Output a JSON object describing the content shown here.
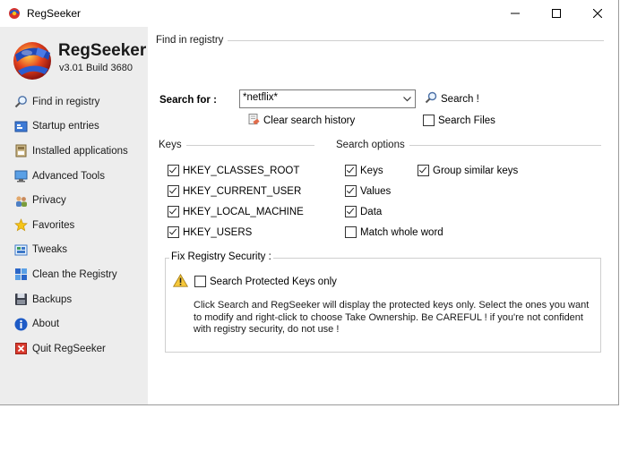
{
  "window": {
    "title": "RegSeeker"
  },
  "sidebar": {
    "app_name": "RegSeeker",
    "version": "v3.01 Build 3680",
    "items": [
      {
        "label": "Find in registry",
        "icon": "magnifier-icon"
      },
      {
        "label": "Startup entries",
        "icon": "startup-icon"
      },
      {
        "label": "Installed applications",
        "icon": "applications-icon"
      },
      {
        "label": "Advanced Tools",
        "icon": "monitor-icon"
      },
      {
        "label": "Privacy",
        "icon": "users-icon"
      },
      {
        "label": "Favorites",
        "icon": "star-icon"
      },
      {
        "label": "Tweaks",
        "icon": "tweaks-icon"
      },
      {
        "label": "Clean the Registry",
        "icon": "registry-icon"
      },
      {
        "label": "Backups",
        "icon": "disk-icon"
      },
      {
        "label": "About",
        "icon": "info-icon"
      },
      {
        "label": "Quit RegSeeker",
        "icon": "quit-icon"
      }
    ]
  },
  "main": {
    "section_title": "Find in registry",
    "search_label": "Search for :",
    "search_value": "*netflix*",
    "search_button": "Search !",
    "clear_history": "Clear search history",
    "search_files": {
      "label": "Search Files",
      "checked": false
    },
    "keys_group": "Keys",
    "keys": [
      {
        "label": "HKEY_CLASSES_ROOT",
        "checked": true
      },
      {
        "label": "HKEY_CURRENT_USER",
        "checked": true
      },
      {
        "label": "HKEY_LOCAL_MACHINE",
        "checked": true
      },
      {
        "label": "HKEY_USERS",
        "checked": true
      }
    ],
    "options_group": "Search options",
    "options": [
      {
        "label": "Keys",
        "checked": true
      },
      {
        "label": "Values",
        "checked": true
      },
      {
        "label": "Data",
        "checked": true
      },
      {
        "label": "Match whole word",
        "checked": false
      }
    ],
    "group_similar": {
      "label": "Group similar keys",
      "checked": true
    },
    "fix": {
      "title": "Fix Registry Security :",
      "protected_only": {
        "label": "Search Protected Keys only",
        "checked": false
      },
      "description": "Click Search and RegSeeker will display the protected keys only. Select the ones you want to modify and right-click to choose Take Ownership. Be CAREFUL ! if you're not confident with registry security, do not use !"
    }
  },
  "colors": {
    "sidebar_bg": "#ededed",
    "highlight": "#cde8ff",
    "accent_blue": "#1e66c8"
  }
}
